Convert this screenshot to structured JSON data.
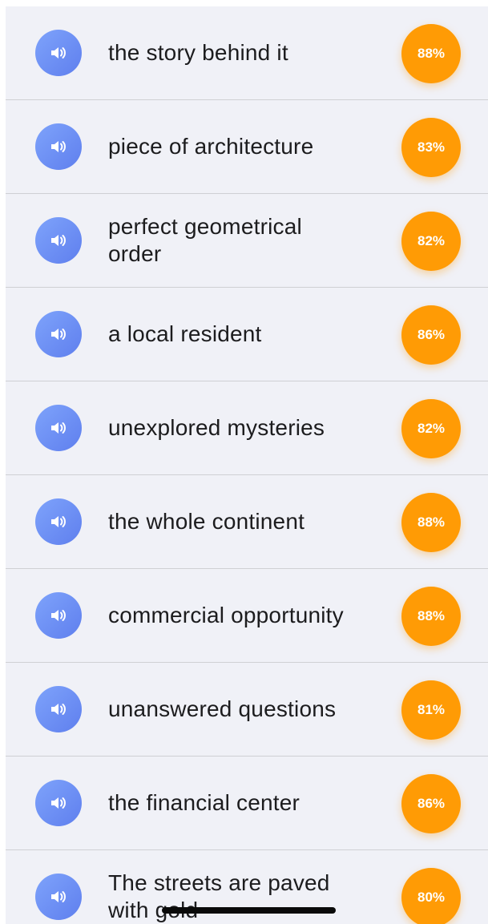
{
  "rows": [
    {
      "phrase": "the story behind it",
      "score": "88%"
    },
    {
      "phrase": "piece of architecture",
      "score": "83%"
    },
    {
      "phrase": "perfect geometrical order",
      "score": "82%"
    },
    {
      "phrase": "a local resident",
      "score": "86%"
    },
    {
      "phrase": "unexplored mysteries",
      "score": "82%"
    },
    {
      "phrase": "the whole continent",
      "score": "88%"
    },
    {
      "phrase": "commercial opportunity",
      "score": "88%"
    },
    {
      "phrase": "unanswered questions",
      "score": "81%"
    },
    {
      "phrase": "the financial center",
      "score": "86%"
    },
    {
      "phrase": "The streets are paved with gold",
      "score": "80%"
    }
  ],
  "icons": {
    "play": "speaker-icon"
  },
  "colors": {
    "list_background": "#f0f1f7",
    "score_badge": "#ff9b05",
    "speaker_button": "#6b8cf4",
    "separator": "#cfd0d4"
  }
}
